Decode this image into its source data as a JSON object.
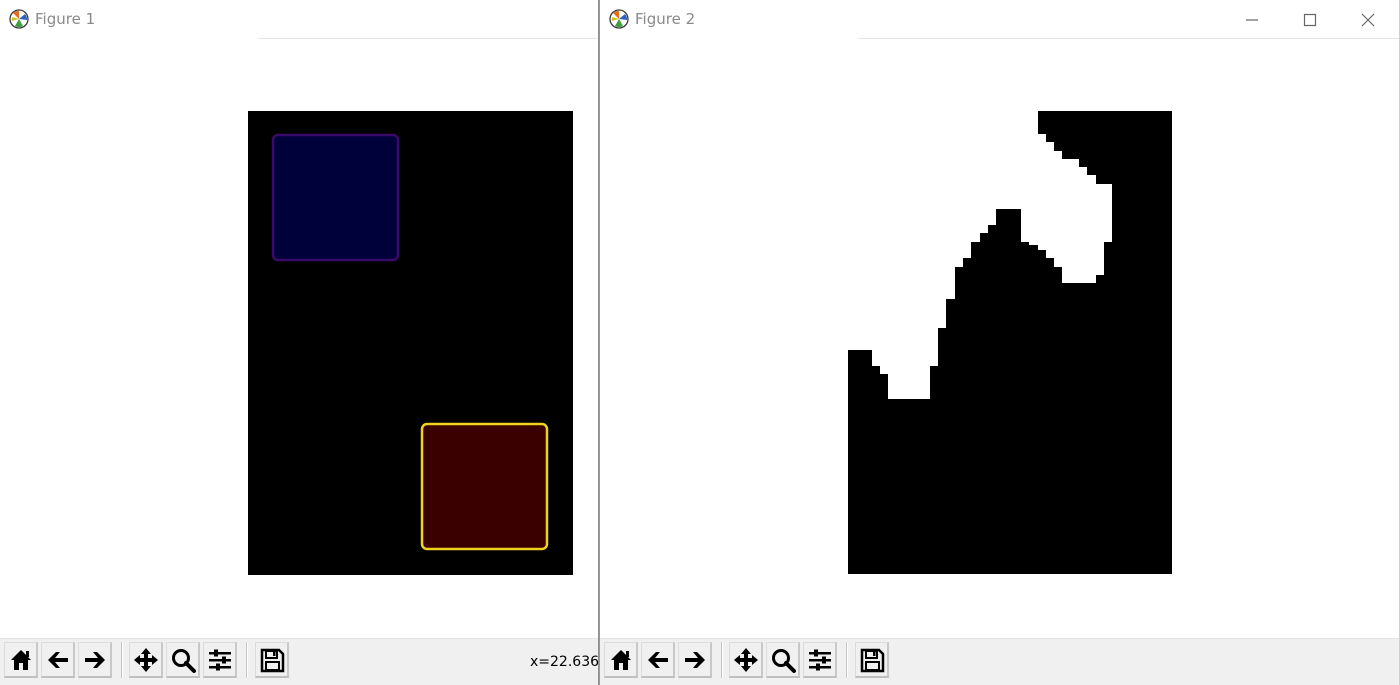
{
  "figure1": {
    "title": "Figure 1",
    "coordinate_readout": "x=22.636",
    "image": {
      "background_color": "#000000",
      "regions": [
        {
          "name": "blue-square",
          "fill": "#00003a",
          "outline": "#3a0a6a"
        },
        {
          "name": "red-square",
          "fill": "#3a0000",
          "outline": "#f0d020"
        }
      ]
    }
  },
  "figure2": {
    "title": "Figure 2",
    "image": {
      "foreground_color": "#000000",
      "background_color": "#ffffff"
    }
  },
  "toolbar_icons": [
    "home-icon",
    "back-arrow-icon",
    "forward-arrow-icon",
    "pan-icon",
    "zoom-icon",
    "configure-subplots-icon",
    "save-icon"
  ],
  "window_controls": [
    "minimize-icon",
    "maximize-icon",
    "close-icon"
  ]
}
